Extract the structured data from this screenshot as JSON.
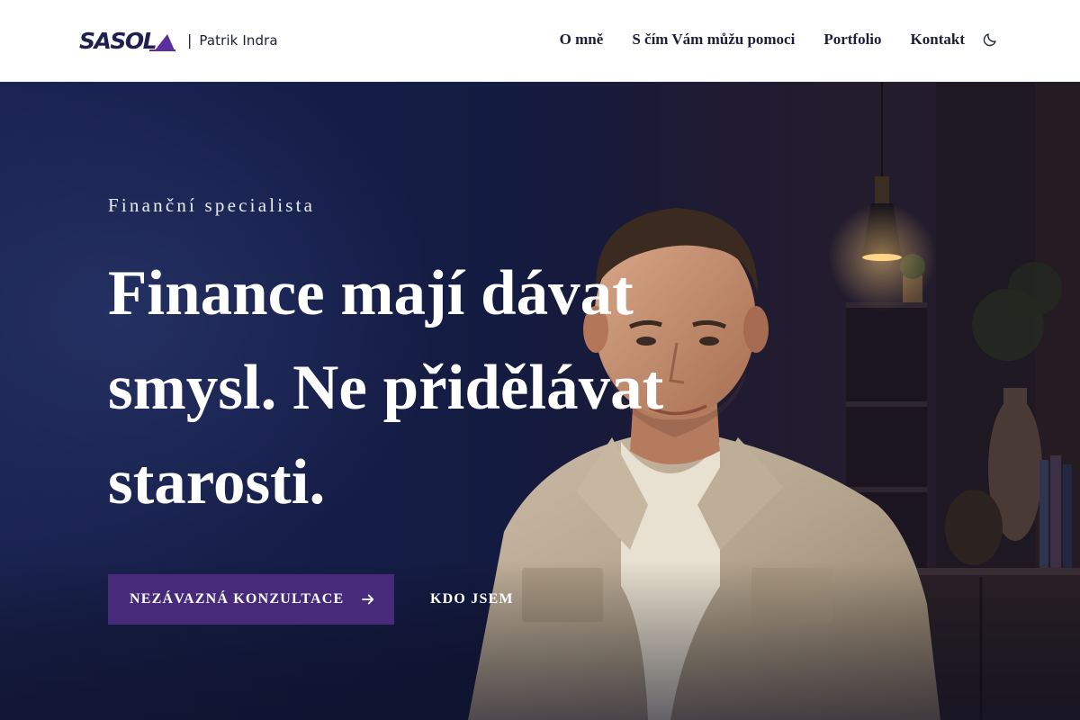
{
  "header": {
    "brand": {
      "logo_text": "SASOL",
      "separator": "|",
      "person_name": "Patrik Indra"
    },
    "nav": [
      {
        "label": "O mně"
      },
      {
        "label": "S čím Vám můžu pomoci"
      },
      {
        "label": "Portfolio"
      },
      {
        "label": "Kontakt"
      }
    ],
    "theme_toggle_icon": "moon-icon"
  },
  "hero": {
    "eyebrow": "Finanční specialista",
    "headline": "Finance mají dávat smysl. Ne přidělávat starosti.",
    "primary_cta": {
      "label": "NEZÁVAZNÁ KONZULTACE",
      "icon": "arrow-right-icon"
    },
    "secondary_cta": {
      "label": "KDO JSEM"
    },
    "photo": "portrait-man-beige-jacket"
  },
  "colors": {
    "header_bg": "#ffffff",
    "nav_text": "#1b1f3b",
    "hero_bg": "#141a3e",
    "accent": "#472a7a",
    "hero_text": "#ffffff"
  }
}
